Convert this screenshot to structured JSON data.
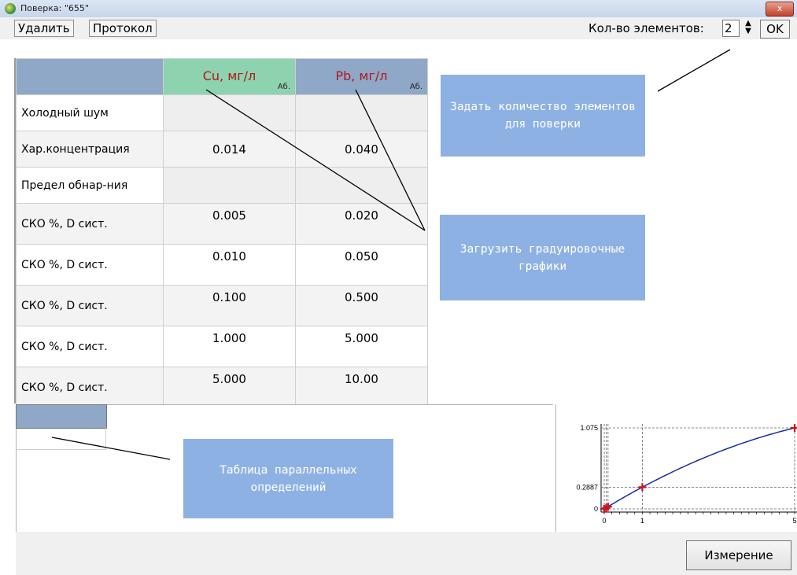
{
  "window": {
    "title": "Поверка: \"655\"",
    "close_glyph": "x"
  },
  "toolbar": {
    "delete_label": "Удалить",
    "protocol_label": "Протокол",
    "count_label": "Кол-во элементов:",
    "count_value": "2",
    "ok_label": "OK"
  },
  "table": {
    "columns": [
      {
        "name": "Cu, мг/л",
        "suffix": "Аб.",
        "color": "#8ed3b0"
      },
      {
        "name": "Pb, мг/л",
        "suffix": "Аб.",
        "color": "#8fa8c8"
      }
    ],
    "rows": [
      {
        "label": "Холодный шум",
        "values": [
          "",
          ""
        ]
      },
      {
        "label": "Хар.концентрация",
        "values": [
          "0.014",
          "0.040"
        ]
      },
      {
        "label": "Предел обнар-ния",
        "values": [
          "",
          ""
        ]
      },
      {
        "label": "СКО %, D сист.",
        "values": [
          "0.005",
          "0.020"
        ]
      },
      {
        "label": "СКО %, D сист.",
        "values": [
          "0.010",
          "0.050"
        ]
      },
      {
        "label": "СКО %, D сист.",
        "values": [
          "0.100",
          "0.500"
        ]
      },
      {
        "label": "СКО %, D сист.",
        "values": [
          "1.000",
          "5.000"
        ]
      },
      {
        "label": "СКО %, D сист.",
        "values": [
          "5.000",
          "10.00"
        ]
      }
    ]
  },
  "callouts": {
    "set_count": "Задать количество элементов для поверки",
    "load_graphs": "Загрузить градуировочные графики",
    "parallel_table": "Таблица параллельных определений"
  },
  "chart_data": {
    "type": "line",
    "x": [
      0,
      0.05,
      0.1,
      1,
      5
    ],
    "y": [
      0,
      0.015,
      0.03,
      0.2887,
      1.075
    ],
    "y_ticks": [
      "1.075",
      "0.2887",
      "0"
    ],
    "x_ticks": [
      "0",
      "1",
      "5"
    ],
    "xlim": [
      0,
      5
    ],
    "ylim": [
      0,
      1.075
    ],
    "line_color": "#1a2fa0",
    "marker_color": "#d01020",
    "grid": "dashed at data points"
  },
  "footer": {
    "measure_label": "Измерение"
  },
  "colors": {
    "callout": "#8eb1e3",
    "header_blue": "#8fa8c8",
    "header_green": "#8ed3b0"
  }
}
